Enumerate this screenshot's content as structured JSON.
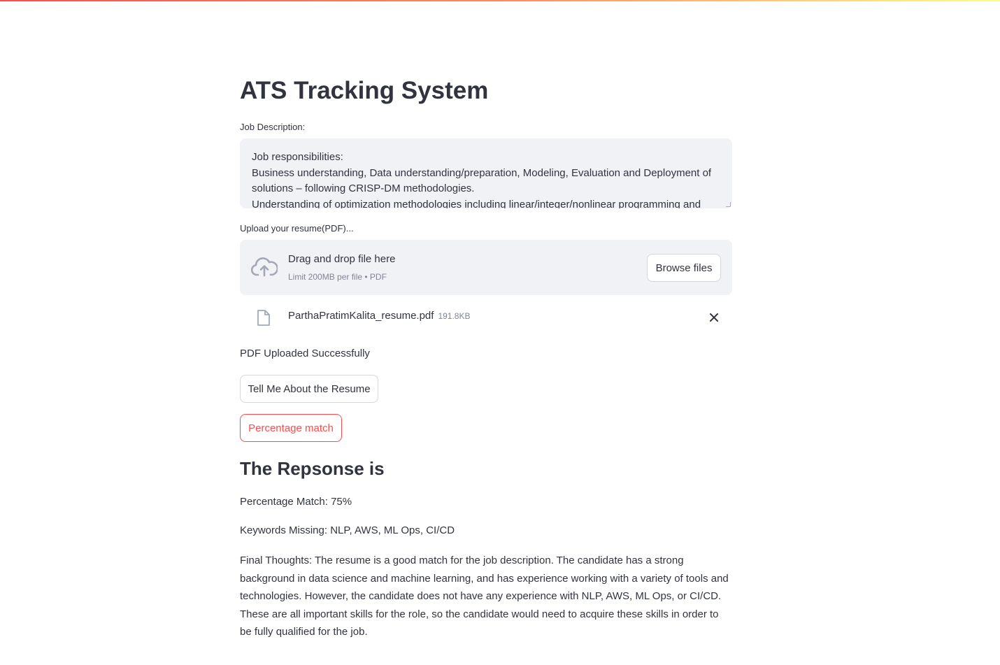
{
  "app": {
    "title": "ATS Tracking System",
    "accent_color": "#ff4b4b",
    "text_color": "#31333f",
    "muted_color": "#808495",
    "panel_color": "#f0f2f6"
  },
  "job_description": {
    "label": "Job Description:",
    "lines": [
      "Job responsibilities:",
      "Business understanding, Data understanding/preparation, Modeling, Evaluation and Deployment of",
      "solutions – following CRISP-DM methodologies.",
      "Understanding of optimization methodologies including linear/integer/nonlinear programming and"
    ]
  },
  "uploader": {
    "label": "Upload your resume(PDF)...",
    "drop_title": "Drag and drop file here",
    "drop_limit": "Limit 200MB per file • PDF",
    "browse_label": "Browse files",
    "icon": "cloud-upload-icon"
  },
  "uploaded_file": {
    "name": "ParthaPratimKalita_resume.pdf",
    "size": "191.8KB",
    "icon": "file-icon",
    "remove_icon": "close-icon"
  },
  "status": {
    "message": "PDF Uploaded Successfully"
  },
  "actions": {
    "tell_me_label": "Tell Me About the Resume",
    "percentage_label": "Percentage match"
  },
  "response": {
    "heading": "The Repsonse is",
    "percentage_line": "Percentage Match: 75%",
    "keywords_line": "Keywords Missing: NLP, AWS, ML Ops, CI/CD",
    "final_lines": [
      "Final Thoughts: The resume is a good match for the job description. The candidate has a strong",
      "background in data science and machine learning, and has experience working with a variety of tools and",
      "technologies. However, the candidate does not have any experience with NLP, AWS, ML Ops, or CI/CD.",
      "These are all important skills for the role, so the candidate would need to acquire these skills in order to",
      "be fully qualified for the job."
    ]
  }
}
